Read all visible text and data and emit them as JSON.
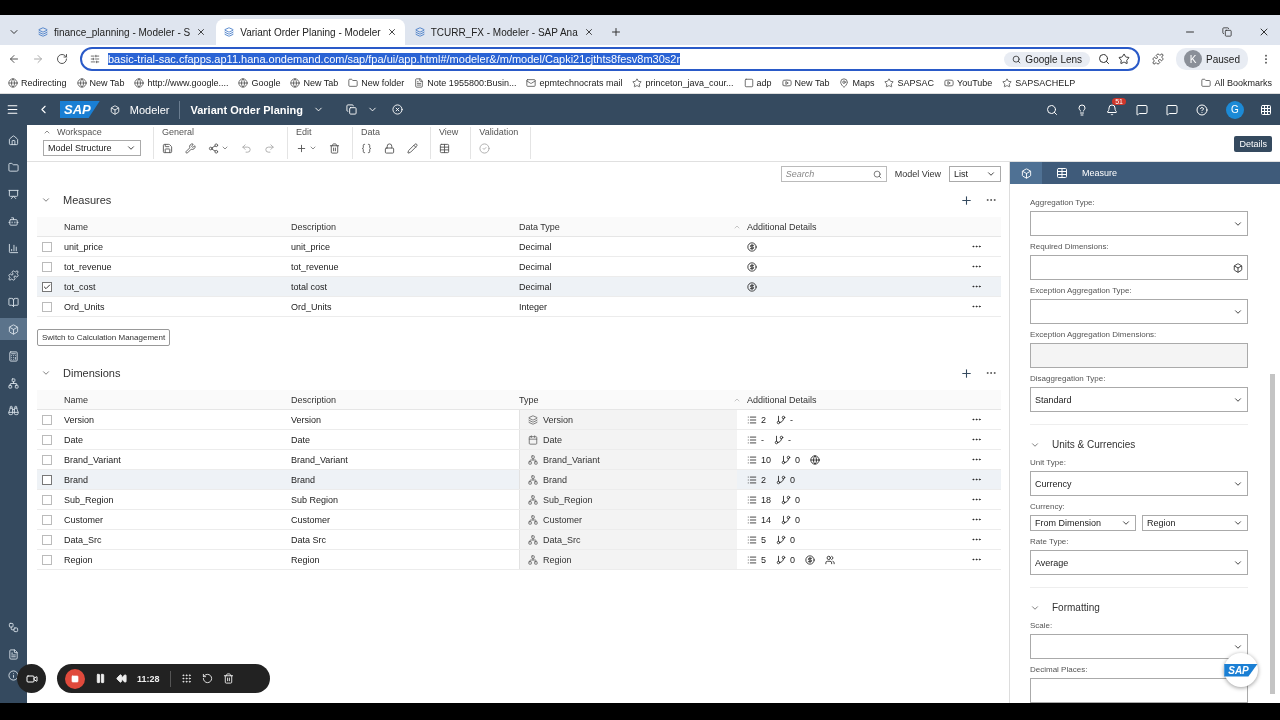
{
  "browser": {
    "tabs": [
      {
        "title": "finance_planning - Modeler - S",
        "selected": false
      },
      {
        "title": "Variant Order Planing - Modeler",
        "selected": true
      },
      {
        "title": "TCURR_FX - Modeler - SAP Ana",
        "selected": false
      }
    ],
    "url": "basic-trial-sac.cfapps.ap11.hana.ondemand.com/sap/fpa/ui/app.html#/modeler&/m/model/Capki21cjthts8fesv8m30s2r",
    "lens": "Google Lens",
    "profile": {
      "initial": "K",
      "label": "Paused"
    },
    "bookmarks": [
      "Redirecting",
      "New Tab",
      "http://www.google....",
      "Google",
      "New Tab",
      "New folder",
      "Note 1955800:Busin...",
      "epmtechnocrats mail",
      "princeton_java_cour...",
      "adp",
      "New Tab",
      "Maps",
      "SAPSAC",
      "YouTube",
      "SAPSACHELP"
    ],
    "all_bookmarks": "All Bookmarks"
  },
  "shell": {
    "logo": "SAP",
    "app": "Modeler",
    "title": "Variant Order Planing",
    "notifications": "51",
    "avatar": "G"
  },
  "sidebar": [
    {
      "selected": false
    },
    {
      "selected": false
    },
    {
      "selected": false
    },
    {
      "selected": false
    },
    {
      "selected": false
    },
    {
      "selected": false
    },
    {
      "selected": false
    },
    {
      "selected": true
    },
    {
      "selected": false
    },
    {
      "selected": false
    },
    {
      "selected": false
    },
    {
      "selected": false
    },
    {
      "selected": false
    }
  ],
  "toolbar": {
    "groups": [
      {
        "kind": "workspace",
        "label": "Workspace",
        "value": "Model Structure"
      },
      {
        "kind": "general",
        "label": "General"
      },
      {
        "kind": "edit",
        "label": "Edit"
      },
      {
        "kind": "data",
        "label": "Data"
      },
      {
        "kind": "view",
        "label": "View"
      },
      {
        "kind": "validation",
        "label": "Validation"
      }
    ],
    "details": "Details"
  },
  "filter": {
    "search_placeholder": "Search",
    "model_view_label": "Model View",
    "model_view": "List"
  },
  "measures": {
    "title": "Measures",
    "expanded": true,
    "columns": [
      "Name",
      "Description",
      "Data Type",
      "Additional Details"
    ],
    "rows": [
      {
        "name": "unit_price",
        "description": "unit_price",
        "data_type": "Decimal",
        "currency": true,
        "selected": false
      },
      {
        "name": "tot_revenue",
        "description": "tot_revenue",
        "data_type": "Decimal",
        "currency": true,
        "selected": false
      },
      {
        "name": "tot_cost",
        "description": "total cost",
        "data_type": "Decimal",
        "currency": true,
        "selected": true
      },
      {
        "name": "Ord_Units",
        "description": "Ord_Units",
        "data_type": "Integer",
        "currency": false,
        "selected": false
      }
    ],
    "button": "Switch to Calculation Management"
  },
  "dimensions": {
    "title": "Dimensions",
    "expanded": true,
    "columns": [
      "Name",
      "Description",
      "Type",
      "Additional Details"
    ],
    "rows": [
      {
        "name": "Version",
        "description": "Version",
        "type": "Version",
        "kind": "version",
        "members": "2",
        "hierarchies": "-",
        "extras": [],
        "highlighted": false
      },
      {
        "name": "Date",
        "description": "Date",
        "type": "Date",
        "kind": "date",
        "members": "-",
        "hierarchies": "-",
        "extras": [],
        "highlighted": false
      },
      {
        "name": "Brand_Variant",
        "description": "Brand_Variant",
        "type": "Brand_Variant",
        "kind": "generic",
        "members": "10",
        "hierarchies": "0",
        "extras": [
          {
            "kind": "globe"
          }
        ],
        "highlighted": false
      },
      {
        "name": "Brand",
        "description": "Brand",
        "type": "Brand",
        "kind": "generic",
        "members": "2",
        "hierarchies": "0",
        "extras": [],
        "highlighted": true
      },
      {
        "name": "Sub_Region",
        "description": "Sub Region",
        "type": "Sub_Region",
        "kind": "generic",
        "members": "18",
        "hierarchies": "0",
        "extras": [],
        "highlighted": false
      },
      {
        "name": "Customer",
        "description": "Customer",
        "type": "Customer",
        "kind": "generic",
        "members": "14",
        "hierarchies": "0",
        "extras": [],
        "highlighted": false
      },
      {
        "name": "Data_Src",
        "description": "Data Src",
        "type": "Data_Src",
        "kind": "generic",
        "members": "5",
        "hierarchies": "0",
        "extras": [],
        "highlighted": false
      },
      {
        "name": "Region",
        "description": "Region",
        "type": "Region",
        "kind": "generic",
        "members": "5",
        "hierarchies": "0",
        "extras": [
          {
            "kind": "currency"
          },
          {
            "kind": "users"
          }
        ],
        "highlighted": false
      }
    ]
  },
  "panel": {
    "tab": "Measure",
    "sections": [
      {
        "fields": [
          {
            "kind": "select",
            "label": "Aggregation Type:"
          },
          {
            "kind": "picker",
            "label": "Required Dimensions:"
          },
          {
            "kind": "select",
            "label": "Exception Aggregation Type:"
          },
          {
            "kind": "disabled",
            "label": "Exception Aggregation Dimensions:"
          },
          {
            "kind": "select",
            "label": "Disaggregation Type:",
            "value": "Standard"
          }
        ]
      },
      {
        "title": "Units & Currencies",
        "expanded": true,
        "fields": [
          {
            "kind": "select",
            "label": "Unit Type:",
            "value": "Currency"
          },
          {
            "kind": "pair",
            "label": "Currency:",
            "values": [
              "From Dimension",
              "Region"
            ]
          },
          {
            "kind": "select",
            "label": "Rate Type:",
            "value": "Average"
          }
        ]
      },
      {
        "title": "Formatting",
        "expanded": true,
        "fields": [
          {
            "kind": "select",
            "label": "Scale:"
          },
          {
            "kind": "input",
            "label": "Decimal Places:"
          }
        ]
      }
    ],
    "assistant": "SAP"
  },
  "recorder": {
    "time": "11:28"
  }
}
